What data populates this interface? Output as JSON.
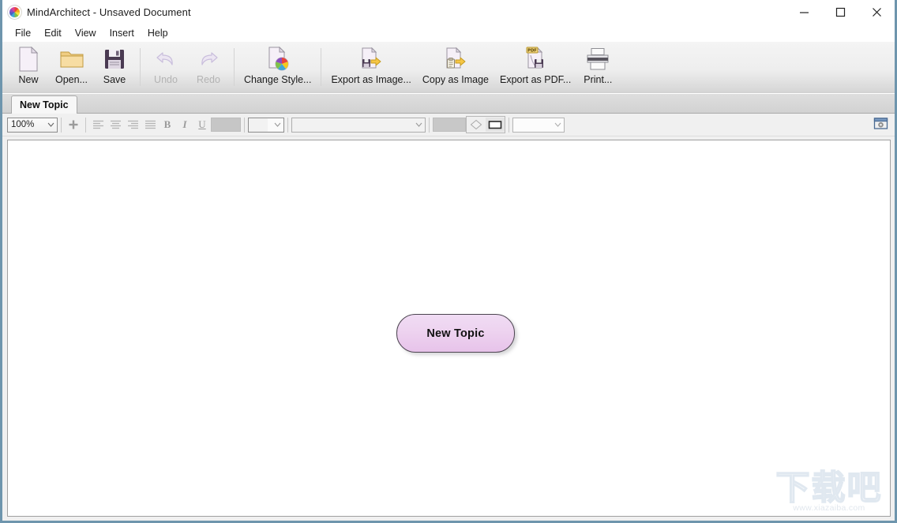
{
  "window": {
    "title": "MindArchitect - Unsaved Document",
    "app_icon": "color-wheel-icon",
    "controls": [
      {
        "name": "minimize",
        "glyph": "minimize-icon"
      },
      {
        "name": "maximize",
        "glyph": "maximize-icon"
      },
      {
        "name": "close",
        "glyph": "close-icon"
      }
    ]
  },
  "menubar": {
    "items": [
      {
        "label": "File"
      },
      {
        "label": "Edit"
      },
      {
        "label": "View"
      },
      {
        "label": "Insert"
      },
      {
        "label": "Help"
      }
    ]
  },
  "toolbar": {
    "buttons": [
      {
        "label": "New",
        "icon": "new-document-icon",
        "enabled": true
      },
      {
        "label": "Open...",
        "icon": "open-folder-icon",
        "enabled": true
      },
      {
        "label": "Save",
        "icon": "floppy-disk-icon",
        "enabled": true
      },
      {
        "label": "Undo",
        "icon": "undo-arrow-icon",
        "enabled": false
      },
      {
        "label": "Redo",
        "icon": "redo-arrow-icon",
        "enabled": false
      },
      {
        "label": "Change Style...",
        "icon": "color-palette-icon",
        "enabled": true
      },
      {
        "label": "Export as Image...",
        "icon": "export-image-icon",
        "enabled": true
      },
      {
        "label": "Copy as Image",
        "icon": "copy-image-icon",
        "enabled": true
      },
      {
        "label": "Export as PDF...",
        "icon": "export-pdf-icon",
        "enabled": true
      },
      {
        "label": "Print...",
        "icon": "printer-icon",
        "enabled": true
      }
    ]
  },
  "tabs": {
    "items": [
      {
        "label": "New Topic",
        "active": true
      }
    ]
  },
  "formatbar": {
    "zoom": {
      "value": "100%",
      "name": "zoom-level-select"
    },
    "add_button": {
      "glyph": "+",
      "name": "add-topic-button"
    },
    "align": [
      {
        "name": "align-left-icon"
      },
      {
        "name": "align-center-icon"
      },
      {
        "name": "align-right-icon"
      },
      {
        "name": "align-justify-icon"
      }
    ],
    "text_styles": [
      {
        "label": "B",
        "name": "bold-button"
      },
      {
        "label": "I",
        "name": "italic-button"
      },
      {
        "label": "U",
        "name": "underline-button"
      }
    ],
    "text_color_swatch": {
      "color": "#c6c6c6",
      "name": "text-color-swatch"
    },
    "font_size_select": {
      "value": "",
      "name": "font-size-select"
    },
    "font_family_select": {
      "value": "",
      "name": "font-family-select"
    },
    "fill_color_swatch": {
      "color": "#c8c8c8",
      "name": "fill-color-swatch"
    },
    "shapes": [
      {
        "name": "diamond-shape-button",
        "selected": false
      },
      {
        "name": "rectangle-shape-button",
        "selected": true
      }
    ],
    "line_style_select": {
      "value": "",
      "name": "line-style-select"
    },
    "properties_button": {
      "name": "properties-panel-icon"
    }
  },
  "canvas": {
    "nodes": [
      {
        "text": "New Topic",
        "shape": "rounded-rectangle",
        "fill_top": "#f0dcf4",
        "fill_bottom": "#e7c3ea",
        "border_color": "#4c4450"
      }
    ],
    "watermark": {
      "glyphs": "下载吧",
      "url": "www.xiazaiba.com"
    }
  }
}
